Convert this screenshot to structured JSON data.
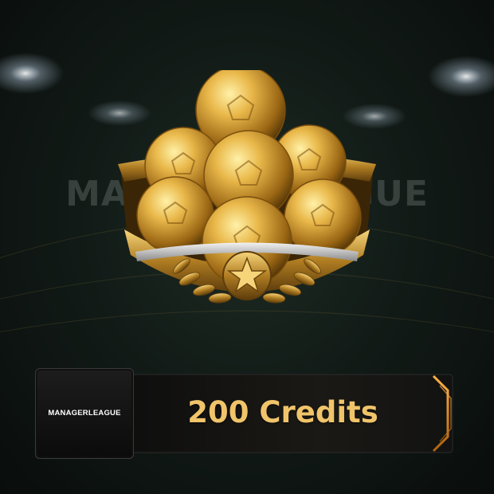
{
  "watermark": "MANAGERLEAGUE",
  "logo": {
    "text": "MANAGERLEAGUE"
  },
  "product": {
    "label": "200 Credits"
  },
  "colors": {
    "gold": "#d9a441",
    "credits_text": "#f0c46a",
    "background": "#121b17"
  },
  "icons": {
    "emblem": "gold-balls-bowl-icon",
    "star": "star-icon",
    "laurel": "laurel-icon"
  }
}
